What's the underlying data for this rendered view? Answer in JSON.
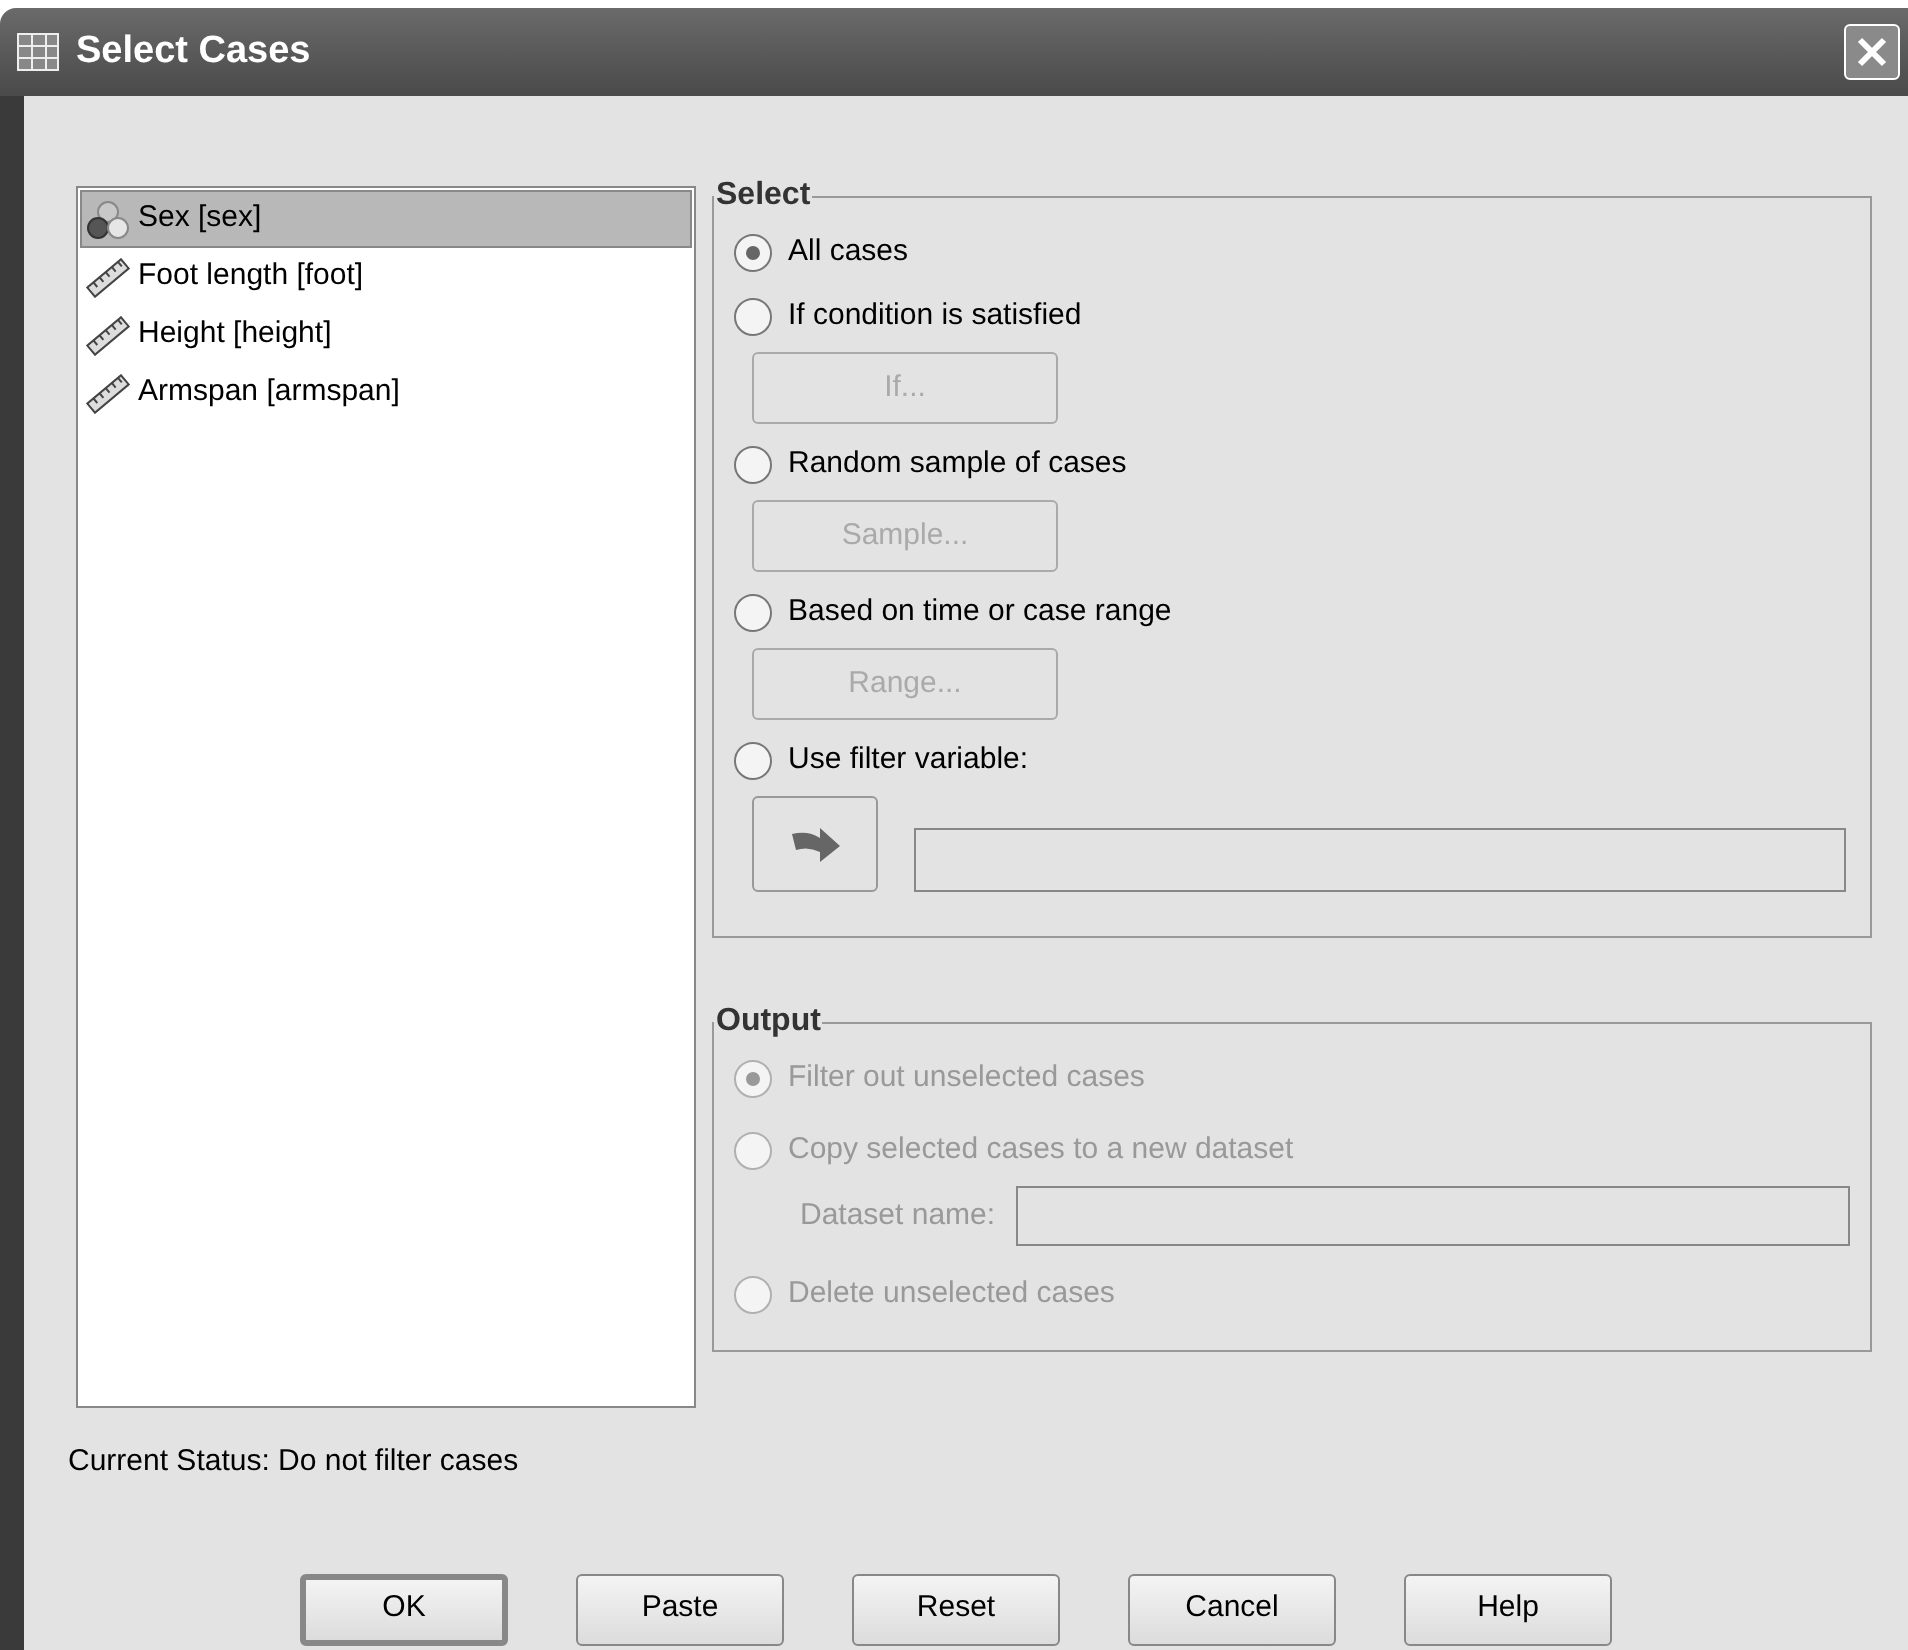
{
  "window": {
    "title": "Select Cases"
  },
  "variables": [
    {
      "label": "Sex [sex]",
      "kind": "nominal",
      "selected": true
    },
    {
      "label": "Foot length [foot]",
      "kind": "scale",
      "selected": false
    },
    {
      "label": "Height [height]",
      "kind": "scale",
      "selected": false
    },
    {
      "label": "Armspan [armspan]",
      "kind": "scale",
      "selected": false
    }
  ],
  "select_group": {
    "title": "Select",
    "options": [
      {
        "label": "All cases",
        "kind": "plain",
        "selected": true
      },
      {
        "label": "If condition is satisfied",
        "kind": "with_button",
        "selected": false,
        "button": {
          "label": "If...",
          "disabled": true
        }
      },
      {
        "label": "Random sample of cases",
        "kind": "with_button",
        "selected": false,
        "button": {
          "label": "Sample...",
          "disabled": true
        }
      },
      {
        "label": "Based on time or case range",
        "kind": "with_button",
        "selected": false,
        "button": {
          "label": "Range...",
          "disabled": true
        }
      },
      {
        "label": "Use filter variable:",
        "kind": "with_filter",
        "selected": false
      }
    ]
  },
  "output_group": {
    "title": "Output",
    "disabled": true,
    "options": [
      {
        "label": "Filter out unselected cases",
        "kind": "plain",
        "selected": true
      },
      {
        "label": "Copy selected cases to a new dataset",
        "kind": "with_name_field",
        "selected": false,
        "field_label": "Dataset name:"
      },
      {
        "label": "Delete unselected cases",
        "kind": "plain",
        "selected": false
      }
    ]
  },
  "status": "Current Status: Do not filter cases",
  "buttons": [
    {
      "label": "OK",
      "default": true
    },
    {
      "label": "Paste",
      "default": false
    },
    {
      "label": "Reset",
      "default": false
    },
    {
      "label": "Cancel",
      "default": false
    },
    {
      "label": "Help",
      "default": false
    }
  ]
}
